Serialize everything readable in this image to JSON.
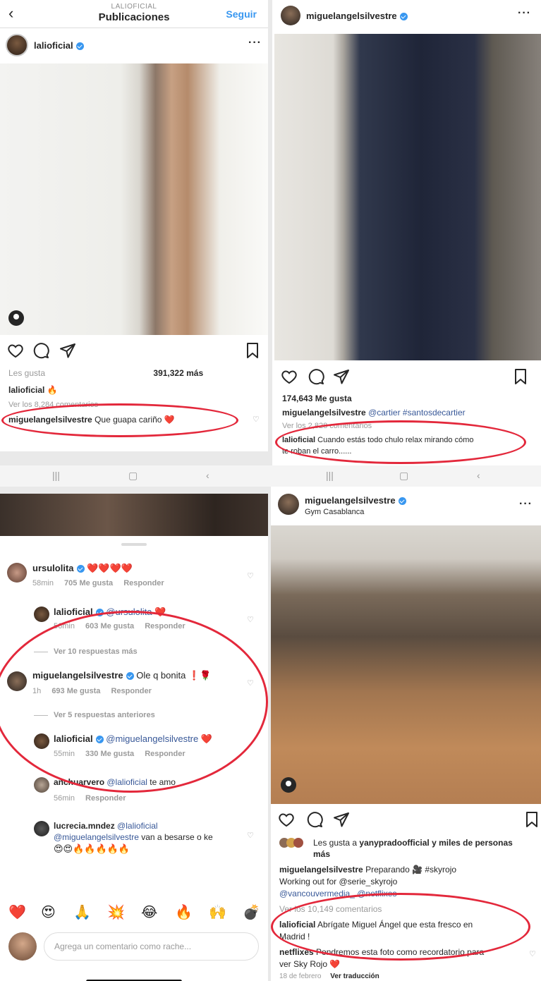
{
  "top_left": {
    "header": {
      "back_icon": "chevron-left-icon",
      "account": "LALIOFICIAL",
      "title": "Publicaciones",
      "follow_label": "Seguir"
    },
    "post": {
      "username": "lalioficial",
      "likes_prefix": "Les gusta",
      "likes_count": "391,322 más",
      "caption_user": "lalioficial",
      "caption_text": "🔥",
      "view_comments": "Ver los 8,284 comentarios",
      "comment_user": "miguelangelsilvestre",
      "comment_text": "Que guapa cariño ❤️"
    }
  },
  "top_right": {
    "post": {
      "username": "miguelangelsilvestre",
      "likes": "174,643 Me gusta",
      "caption_user": "miguelangelsilvestre",
      "caption_text": "@cartier #santosdecartier",
      "view_comments": "Ver los 2,828 comentarios",
      "comment_user": "lalioficial",
      "comment_text_1": "Cuando estás todo chulo relax mirando cómo",
      "comment_text_2": "te roban el carro......"
    }
  },
  "bottom_left": {
    "comments": [
      {
        "user": "ursulolita",
        "text": "❤️❤️❤️❤️",
        "time": "58min",
        "likes": "705 Me gusta",
        "reply": "Responder"
      },
      {
        "user": "lalioficial",
        "mention": "@ursulolita",
        "text": "❤️",
        "time": "56min",
        "likes": "603 Me gusta",
        "reply": "Responder"
      },
      {
        "user": "miguelangelsilvestre",
        "text": "Ole q bonita ❗🌹",
        "time": "1h",
        "likes": "693 Me gusta",
        "reply": "Responder"
      },
      {
        "user": "lalioficial",
        "mention": "@miguelangelsilvestre",
        "text": "❤️",
        "time": "55min",
        "likes": "330 Me gusta",
        "reply": "Responder"
      },
      {
        "user": "anchuarvero",
        "mention": "@lalioficial",
        "text": "te amo",
        "time": "56min",
        "reply": "Responder"
      },
      {
        "user": "lucrecia.mndez",
        "mention": "@lalioficial",
        "mention2": "@miguelangelsilvestre",
        "text": "van a besarse o ke",
        "emojis": "😍😍🔥🔥🔥🔥🔥"
      }
    ],
    "view_more_replies": "Ver 10 respuestas más",
    "view_previous_replies": "Ver 5 respuestas anteriores",
    "emoji_bar": [
      "❤️",
      "😍",
      "🙏",
      "💥",
      "😂",
      "🔥",
      "🙌",
      "💣"
    ],
    "comment_placeholder": "Agrega un comentario como rache..."
  },
  "bottom_right": {
    "post": {
      "username": "miguelangelsilvestre",
      "location": "Gym Casablanca",
      "likes_prefix": "Les gusta a",
      "likes_user": "yanyprado​official",
      "likes_suffix": "y miles de personas",
      "likes_suffix_2": "más",
      "caption_user": "miguelangelsilvestre",
      "caption_text": "Preparando 🎥 #skyrojo",
      "caption_line2": "Working out for @serie_skyrojo",
      "caption_line3": "@vancouvermedia_ @netflixes",
      "view_comments": "Ver los 10,149 comentarios",
      "comment_user": "lalioficial",
      "comment_text_1": "Abrígate Miguel Ángel que esta fresco en",
      "comment_text_2": "Madrid !",
      "comment2_user": "netflixes",
      "comment2_text_1": "Pondremos esta foto como recordatorio para",
      "comment2_text_2": "ver Sky Rojo ❤️",
      "date": "18 de febrero",
      "translate": "Ver traducción"
    }
  },
  "colors": {
    "highlight_ellipse": "#e3283b",
    "link_blue": "#3897f0",
    "verified_blue": "#3897f0"
  }
}
